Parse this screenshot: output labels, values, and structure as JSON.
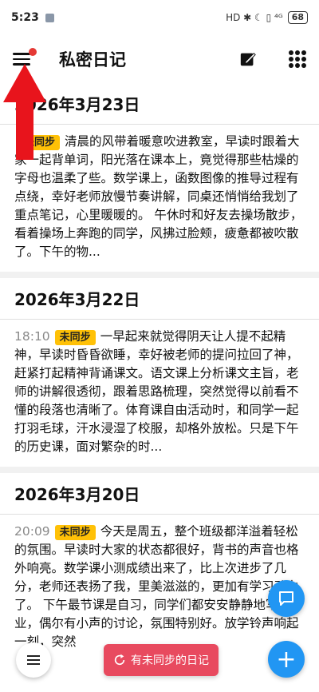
{
  "status": {
    "time": "5:23",
    "battery": "68",
    "indicators": "HD ✱ ☾ ▯ ⁴ᴳ"
  },
  "app": {
    "title": "私密日记"
  },
  "days": [
    {
      "date": "2026年3月23日",
      "time": "",
      "badge": "未同步",
      "text": "清晨的风带着暖意吹进教室，早读时跟着大家一起背单词，阳光落在课本上，竟觉得那些枯燥的字母也温柔了些。数学课上，函数图像的推导过程有点绕，幸好老师放慢节奏讲解，同桌还悄悄给我划了重点笔记，心里暖暖的。 午休时和好友去操场散步，看着操场上奔跑的同学，风拂过脸颊，疲惫都被吹散了。下午的物..."
    },
    {
      "date": "2026年3月22日",
      "time": "18:10",
      "badge": "未同步",
      "text": "一早起来就觉得阴天让人提不起精神，早读时昏昏欲睡，幸好被老师的提问拉回了神，赶紧打起精神背诵课文。语文课上分析课文主旨，老师的讲解很透彻，跟着思路梳理，突然觉得以前看不懂的段落也清晰了。体育课自由活动时，和同学一起打羽毛球，汗水浸湿了校服，却格外放松。只是下午的历史课，面对繁杂的时..."
    },
    {
      "date": "2026年3月20日",
      "time": "20:09",
      "badge": "未同步",
      "text": "今天是周五，整个班级都洋溢着轻松的氛围。早读时大家的状态都很好，背书的声音也格外响亮。数学课小测成绩出来了，比上次进步了几分，老师还表扬了我，里美滋滋的，更加有学习动力了。 下午最节课是自习，同学们都安安静静地写作业，偶尔有小声的讨论，氛围特别好。放学铃声响起一刻，突然"
    }
  ],
  "bottom": {
    "sync_label": "有未同步的日记"
  },
  "colors": {
    "badge": "#ffc107",
    "fab": "#2196f3",
    "sync": "#e84a5f",
    "arrow": "#e8141c"
  }
}
